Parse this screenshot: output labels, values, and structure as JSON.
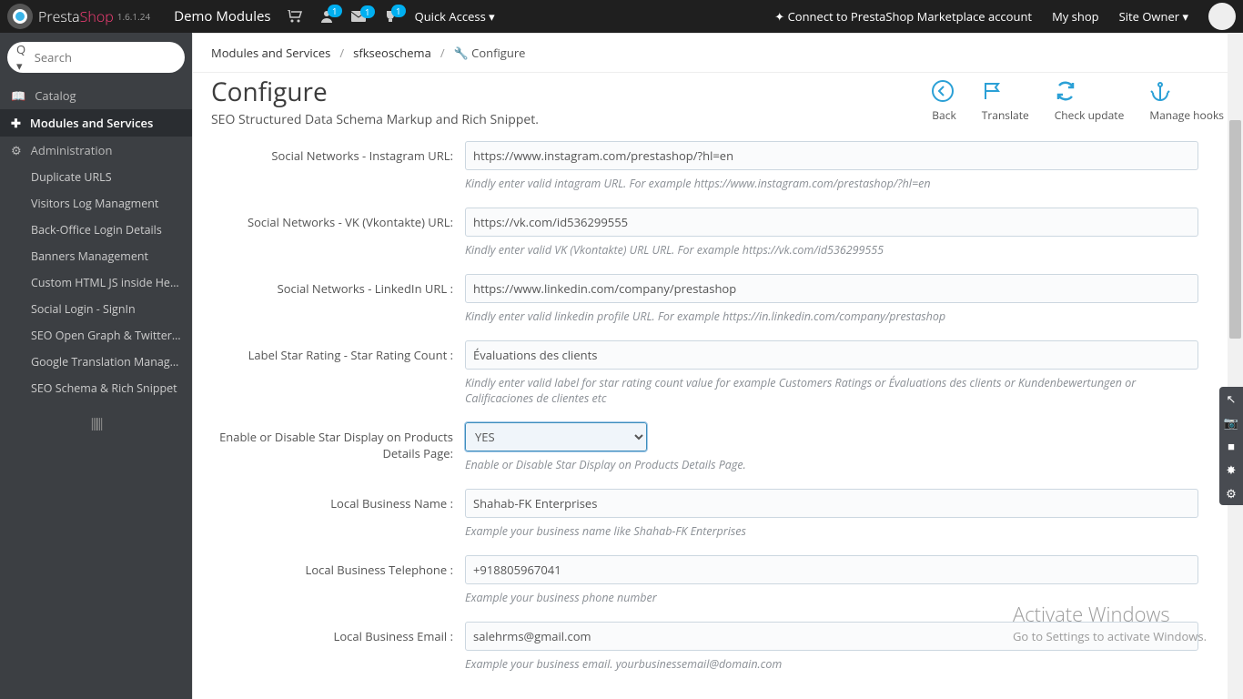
{
  "header": {
    "brand_a": "Presta",
    "brand_b": "Shop",
    "version": "1.6.1.24",
    "demo": "Demo Modules",
    "quick_access": "Quick Access",
    "badge_orders": "1",
    "badge_msgs": "1",
    "badge_trophy": "1",
    "connect": "Connect to PrestaShop Marketplace account",
    "myshop": "My shop",
    "owner": "Site Owner"
  },
  "sidebar": {
    "search_placeholder": "Search",
    "catalog": "Catalog",
    "modules": "Modules and Services",
    "admin": "Administration",
    "items": [
      "Duplicate URLS",
      "Visitors Log Managment",
      "Back-Office Login Details",
      "Banners Management",
      "Custom HTML JS inside Head...",
      "Social Login - SignIn",
      "SEO Open Graph & Twitter C...",
      "Google Translation Manage...",
      "SEO Schema & Rich Snippet"
    ]
  },
  "breadcrumbs": {
    "a": "Modules and Services",
    "b": "sfkseoschema",
    "c": "Configure"
  },
  "page": {
    "title": "Configure",
    "subtitle": "SEO Structured Data Schema Markup and Rich Snippet."
  },
  "actions": {
    "back": "Back",
    "translate": "Translate",
    "check": "Check update",
    "hooks": "Manage hooks"
  },
  "form": {
    "instagram": {
      "label": "Social Networks - Instagram URL:",
      "value": "https://www.instagram.com/prestashop/?hl=en",
      "help": "Kindly enter valid intagram URL. For example https://www.instagram.com/prestashop/?hl=en"
    },
    "vk": {
      "label": "Social Networks - VK (Vkontakte) URL:",
      "value": "https://vk.com/id536299555",
      "help": "Kindly enter valid VK (Vkontakte) URL URL. For example https://vk.com/id536299555"
    },
    "linkedin": {
      "label": "Social Networks - LinkedIn URL :",
      "value": "https://www.linkedin.com/company/prestashop",
      "help": "Kindly enter valid linkedin profile URL. For example https://in.linkedin.com/company/prestashop"
    },
    "starlabel": {
      "label": "Label Star Rating - Star Rating Count :",
      "value": "Évaluations des clients",
      "help": "Kindly enter valid label for star rating count value for example Customers Ratings or Évaluations des clients or Kundenbewertungen or Calificaciones de clientes etc"
    },
    "stardisplay": {
      "label": "Enable or Disable Star Display on Products Details Page:",
      "value": "YES",
      "help": "Enable or Disable Star Display on Products Details Page."
    },
    "bizname": {
      "label": "Local Business Name :",
      "value": "Shahab-FK Enterprises",
      "help": "Example your business name like Shahab-FK Enterprises"
    },
    "biztel": {
      "label": "Local Business Telephone :",
      "value": "+918805967041",
      "help": "Example your business phone number"
    },
    "bizemail": {
      "label": "Local Business Email :",
      "value": "salehrms@gmail.com",
      "help": "Example your business email. yourbusinessemail@domain.com"
    }
  },
  "watermark": {
    "l1": "Activate Windows",
    "l2": "Go to Settings to activate Windows."
  }
}
